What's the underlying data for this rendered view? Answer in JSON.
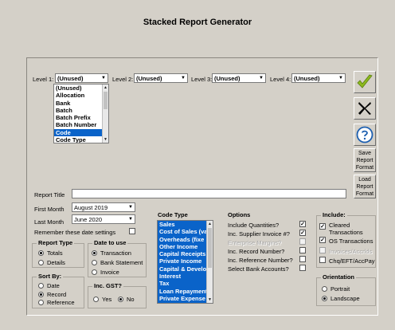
{
  "title": "Stacked Report Generator",
  "levels": [
    {
      "label": "Level 1:",
      "value": "(Unused)"
    },
    {
      "label": "Level 2:",
      "value": "(Unused)"
    },
    {
      "label": "Level 3:",
      "value": "(Unused)"
    },
    {
      "label": "Level 4:",
      "value": "(Unused)"
    }
  ],
  "level1_dropdown": {
    "items": [
      "(Unused)",
      "Allocation",
      "Bank",
      "Batch",
      "Batch Prefix",
      "Batch Number",
      "Code",
      "Code Type"
    ],
    "selected_index": 6
  },
  "side_buttons": {
    "ok_icon": "checkmark-icon",
    "close_icon": "x-icon",
    "help_icon": "question-icon",
    "save_label": "Save Report Format",
    "load_label": "Load Report Format"
  },
  "report_title": {
    "label": "Report Title",
    "value": ""
  },
  "first_month": {
    "label": "First Month",
    "value": "August 2019"
  },
  "last_month": {
    "label": "Last Month",
    "value": "June 2020"
  },
  "remember_dates": {
    "label": "Remember these date settings",
    "checked": false
  },
  "report_type": {
    "title": "Report Type",
    "options": [
      "Totals",
      "Details"
    ],
    "selected": "Totals"
  },
  "sort_by": {
    "title": "Sort By:",
    "options": [
      "Date",
      "Record",
      "Reference"
    ],
    "selected": "Record"
  },
  "date_to_use": {
    "title": "Date to use",
    "options": [
      "Transaction",
      "Bank Statement",
      "Invoice"
    ],
    "selected": "Transaction"
  },
  "inc_gst": {
    "title": "Inc. GST?",
    "options": [
      "Yes",
      "No"
    ],
    "selected": "No"
  },
  "code_type": {
    "title": "Code Type",
    "items": [
      "Sales",
      "Cost of Sales (va",
      "Overheads (fixe",
      "Other  Income",
      "Capital Receipts",
      "Private Income",
      "Capital & Develo",
      "Interest",
      "Tax",
      "Loan Repayment",
      "Private Expense"
    ]
  },
  "options": {
    "title": "Options",
    "items": [
      {
        "label": "Include Quantities?",
        "checked": true,
        "disabled": false
      },
      {
        "label": "Inc. Supplier Invoice #?",
        "checked": true,
        "disabled": false
      },
      {
        "label": "Enterprise Margins?",
        "checked": false,
        "disabled": true
      },
      {
        "label": "Inc. Record Number?",
        "checked": false,
        "disabled": false
      },
      {
        "label": "Inc. Reference Number?",
        "checked": false,
        "disabled": false
      },
      {
        "label": "Select Bank Accounts?",
        "checked": false,
        "disabled": false
      }
    ]
  },
  "include": {
    "title": "Include:",
    "items": [
      {
        "label": "Cleared Transactions",
        "checked": true,
        "disabled": false
      },
      {
        "label": "OS Transactions",
        "checked": true,
        "disabled": false
      },
      {
        "label": "Invoices/Accrlds",
        "checked": false,
        "disabled": true
      },
      {
        "label": "Chq/EFT/AccPay",
        "checked": false,
        "disabled": false
      }
    ]
  },
  "orientation": {
    "title": "Orientation",
    "options": [
      "Portrait",
      "Landscape"
    ],
    "selected": "Landscape"
  },
  "colors": {
    "accent": "#0a63c9",
    "ok_green": "#8dba1e",
    "help_blue": "#1d5fb0",
    "bg": "#d4d0c8"
  }
}
